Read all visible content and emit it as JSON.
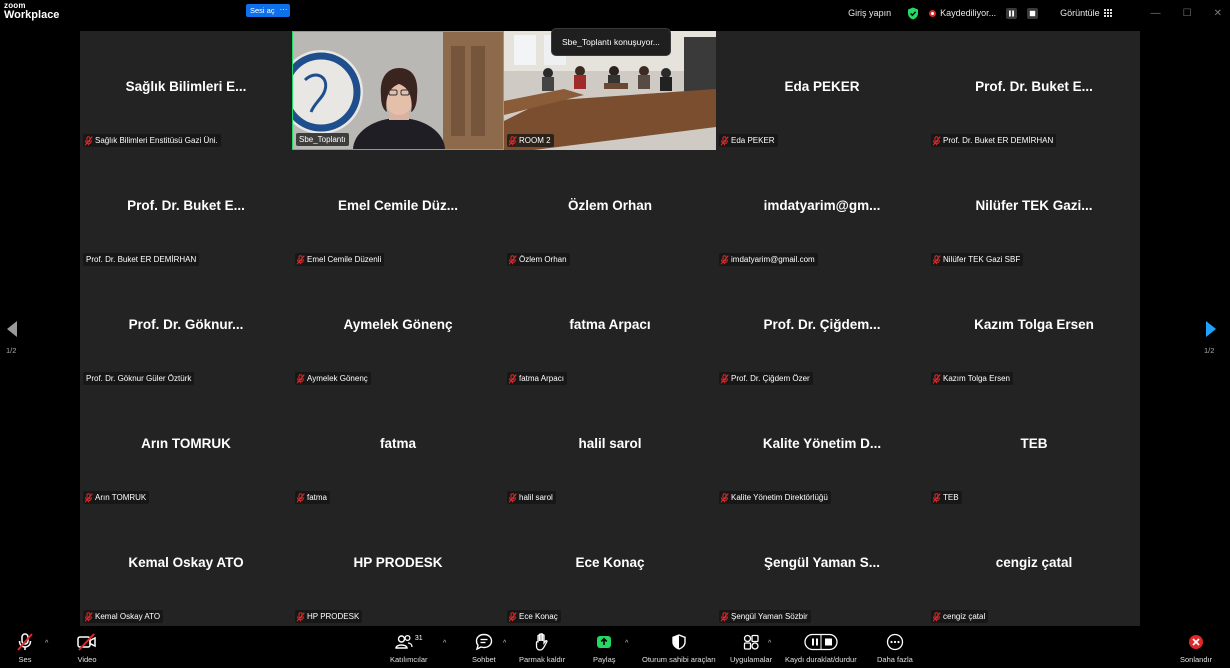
{
  "app": {
    "logo_line1": "zoom",
    "logo_line2": "Workplace"
  },
  "titlebar": {
    "login": "Giriş yapın",
    "recording": "Kaydediliyor...",
    "view": "Görüntüle",
    "win_min": "—",
    "win_max": "☐",
    "win_close": "✕"
  },
  "overlay": {
    "unmute_label": "Sesi aç",
    "more_label": "···",
    "speaking": "Sbe_Toplantı konuşuyor..."
  },
  "pagination": {
    "left": "1/2",
    "right": "1/2"
  },
  "tiles": [
    {
      "name": "Sağlık Bilimleri E...",
      "label": "Sağlık Bilimleri Enstitüsü Gazi Üni.",
      "muted": true
    },
    {
      "name": "",
      "label": "Sbe_Toplantı",
      "muted": false,
      "video": "logo-room",
      "active": true
    },
    {
      "name": "",
      "label": "ROOM 2",
      "muted": true,
      "video": "meeting-room"
    },
    {
      "name": "Eda PEKER",
      "label": "Eda PEKER",
      "muted": true
    },
    {
      "name": "Prof. Dr. Buket E...",
      "label": "Prof. Dr. Buket ER DEMİRHAN",
      "muted": true
    },
    {
      "name": "Prof. Dr. Buket E...",
      "label": "Prof. Dr. Buket ER DEMİRHAN",
      "muted": false
    },
    {
      "name": "Emel Cemile Düz...",
      "label": "Emel Cemile Düzenli",
      "muted": true
    },
    {
      "name": "Özlem Orhan",
      "label": "Özlem Orhan",
      "muted": true
    },
    {
      "name": "imdatyarim@gm...",
      "label": "imdatyarim@gmail.com",
      "muted": true
    },
    {
      "name": "Nilüfer TEK Gazi...",
      "label": "Nilüfer TEK Gazi SBF",
      "muted": true
    },
    {
      "name": "Prof. Dr. Göknur...",
      "label": "Prof. Dr. Göknur Güler Öztürk",
      "muted": false
    },
    {
      "name": "Aymelek Gönenç",
      "label": "Aymelek Gönenç",
      "muted": true
    },
    {
      "name": "fatma Arpacı",
      "label": "fatma Arpacı",
      "muted": true
    },
    {
      "name": "Prof. Dr. Çiğdem...",
      "label": "Prof. Dr. Çiğdem Özer",
      "muted": true
    },
    {
      "name": "Kazım Tolga Ersen",
      "label": "Kazım Tolga Ersen",
      "muted": true
    },
    {
      "name": "Arın TOMRUK",
      "label": "Arın TOMRUK",
      "muted": true
    },
    {
      "name": "fatma",
      "label": "fatma",
      "muted": true
    },
    {
      "name": "halil sarol",
      "label": "halil sarol",
      "muted": true
    },
    {
      "name": "Kalite Yönetim D...",
      "label": "Kalite Yönetim Direktörlüğü",
      "muted": true
    },
    {
      "name": "TEB",
      "label": "TEB",
      "muted": true
    },
    {
      "name": "Kemal  Oskay ATO",
      "label": "Kemal  Oskay ATO",
      "muted": true
    },
    {
      "name": "HP PRODESK",
      "label": "HP PRODESK",
      "muted": true
    },
    {
      "name": "Ece Konaç",
      "label": "Ece Konaç",
      "muted": true
    },
    {
      "name": "Şengül Yaman S...",
      "label": "Şengül Yaman Sözbir",
      "muted": true
    },
    {
      "name": "cengiz çatal",
      "label": "cengiz çatal",
      "muted": true
    }
  ],
  "toolbar": {
    "audio": "Ses",
    "video": "Video",
    "participants": "Katılımcılar",
    "participants_count": "31",
    "chat": "Sohbet",
    "raise_hand": "Parmak kaldır",
    "share": "Paylaş",
    "host_tools": "Oturum sahibi araçları",
    "apps": "Uygulamalar",
    "record": "Kaydı duraklat/durdur",
    "more": "Daha fazla",
    "end": "Sonlandır"
  },
  "colors": {
    "active_speaker": "#23d963",
    "accent": "#0e71eb",
    "share": "#23d963",
    "end": "#e02828",
    "muted_mic": "#e02828",
    "tile_bg": "#232323"
  }
}
